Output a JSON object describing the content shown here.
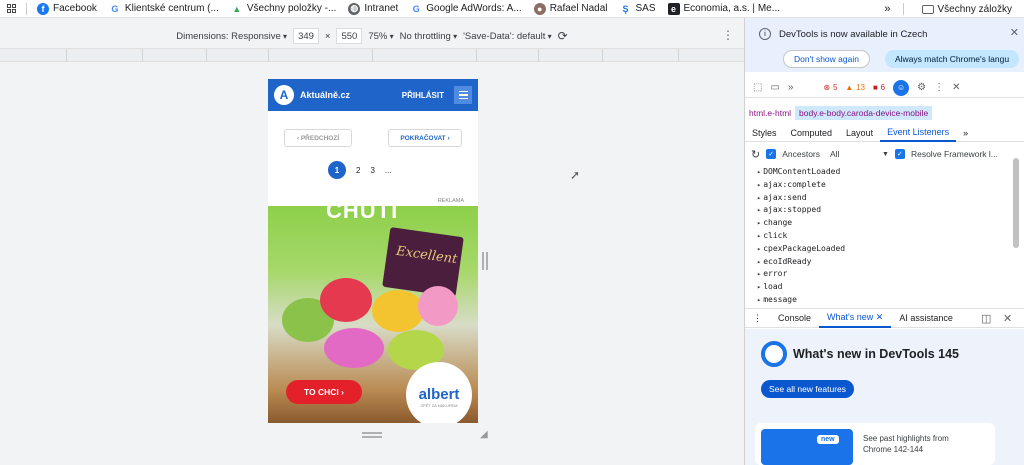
{
  "bookmarks": {
    "items": [
      {
        "label": "Facebook",
        "icon": "facebook-icon",
        "color": "#1877f2"
      },
      {
        "label": "Klientské centrum (...",
        "icon": "google-icon",
        "color": "#4285f4"
      },
      {
        "label": "Všechny položky -...",
        "icon": "drive-icon",
        "color": "#34a853"
      },
      {
        "label": "Intranet",
        "icon": "globe-icon",
        "color": "#5f6368"
      },
      {
        "label": "Google AdWords: A...",
        "icon": "google-icon",
        "color": "#4285f4"
      },
      {
        "label": "Rafael Nadal",
        "icon": "person-icon",
        "color": "#8d6e63"
      },
      {
        "label": "SAS",
        "icon": "s-logo-icon",
        "color": "#1a73e8"
      },
      {
        "label": "Economia, a.s. | Me...",
        "icon": "economia-icon",
        "color": "#202124"
      }
    ],
    "overflow": "»",
    "all_bookmarks": "Všechny záložky"
  },
  "emulation": {
    "dimensions_label": "Dimensions: Responsive",
    "width": "349",
    "times": "×",
    "height": "550",
    "zoom": "75%",
    "throttling": "No throttling",
    "save_data": "'Save-Data': default"
  },
  "phone": {
    "brand": "Aktuálně.cz",
    "logo_letter": "A",
    "login": "PŘIHLÁSIT",
    "prev": "‹  PŘEDCHOZÍ",
    "next": "POKRAČOVAT  ›",
    "pages": [
      "1",
      "2",
      "3",
      "..."
    ],
    "current_page": "1",
    "ad_label": "REKLAMA",
    "ad_heading": "CHUTI",
    "ad_product": "Excellent",
    "ad_button": "TO CHCI  ›",
    "ad_logo": "albert",
    "ad_logo_tag": "ZPĚT ZA NÁKUPEM"
  },
  "devtools": {
    "info": {
      "text": "DevTools is now available in Czech",
      "btn_dismiss": "Don't show again",
      "btn_match": "Always match Chrome's langu"
    },
    "counts": {
      "errors": "5",
      "warnings": "13",
      "issues": "6"
    },
    "breadcrumbs": [
      "html.e-html",
      "body.e-body.caroda-device-mobile"
    ],
    "subtabs": [
      "Styles",
      "Computed",
      "Layout",
      "Event Listeners",
      "»"
    ],
    "active_subtab": "Event Listeners",
    "listener_bar": {
      "ancestors": "Ancestors",
      "filter": "All",
      "resolve": "Resolve Framework l..."
    },
    "events": [
      "DOMContentLoaded",
      "ajax:complete",
      "ajax:send",
      "ajax:stopped",
      "change",
      "click",
      "cpexPackageLoaded",
      "ecoIdReady",
      "error",
      "load",
      "message"
    ],
    "drawer_tabs": [
      "Console",
      "What's new",
      "AI assistance"
    ],
    "active_drawer_tab": "What's new",
    "whats_new": {
      "title": "What's new in DevTools 145",
      "button": "See all new features",
      "card_badge": "new",
      "card_text": "See past highlights from Chrome 142-144"
    }
  },
  "colors": {
    "brand_blue": "#1f64c8",
    "devtools_accent": "#0b57d0",
    "ad_button_red": "#e4202a"
  }
}
